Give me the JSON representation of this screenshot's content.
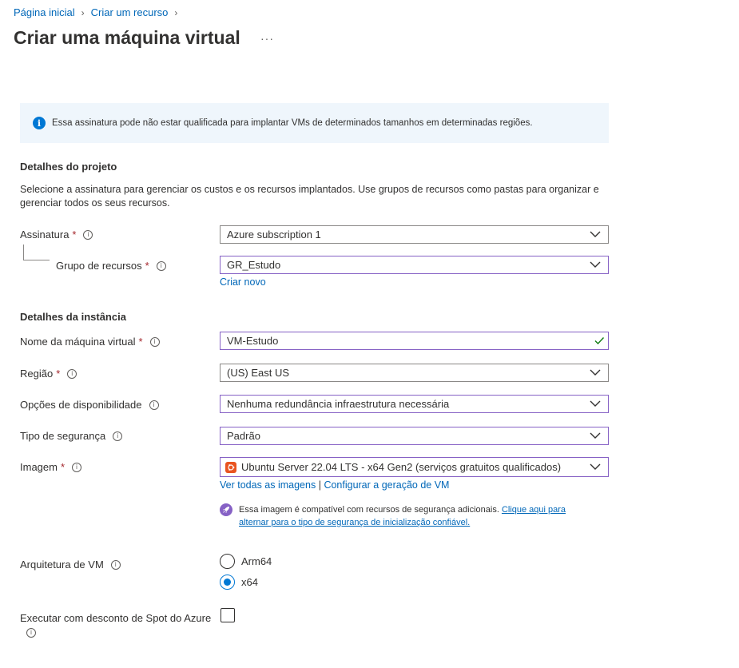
{
  "breadcrumb": {
    "items": [
      "Página inicial",
      "Criar um recurso"
    ]
  },
  "page": {
    "title": "Criar uma máquina virtual",
    "more": "···"
  },
  "banner": {
    "text": "Essa assinatura pode não estar qualificada para implantar VMs de determinados tamanhos em determinadas regiões."
  },
  "project": {
    "title": "Detalhes do projeto",
    "description": "Selecione a assinatura para gerenciar os custos e os recursos implantados. Use grupos de recursos como pastas para organizar e gerenciar todos os seus recursos.",
    "subscription": {
      "label": "Assinatura",
      "required": "*",
      "value": "Azure subscription 1"
    },
    "resource_group": {
      "label": "Grupo de recursos",
      "required": "*",
      "value": "GR_Estudo",
      "create_link": "Criar novo"
    }
  },
  "instance": {
    "title": "Detalhes da instância",
    "vm_name": {
      "label": "Nome da máquina virtual",
      "required": "*",
      "value": "VM-Estudo"
    },
    "region": {
      "label": "Região",
      "required": "*",
      "value": "(US) East US"
    },
    "availability": {
      "label": "Opções de disponibilidade",
      "value": "Nenhuma redundância infraestrutura necessária"
    },
    "security": {
      "label": "Tipo de segurança",
      "value": "Padrão"
    },
    "image": {
      "label": "Imagem",
      "required": "*",
      "value": "Ubuntu Server 22.04 LTS - x64 Gen2 (serviços gratuitos qualificados)",
      "see_all_link": "Ver todas as imagens",
      "separator": "|",
      "configure_link": "Configurar a geração de VM"
    },
    "notice": {
      "text": "Essa imagem é compatível com recursos de segurança adicionais.",
      "link_part1": "Clique aqui para",
      "link_part2": "alternar para o tipo de segurança de inicialização confiável."
    },
    "architecture": {
      "label": "Arquitetura de VM",
      "options": [
        "Arm64",
        "x64"
      ],
      "selected": "x64"
    },
    "spot": {
      "label": "Executar com desconto de Spot do Azure",
      "checked": false
    }
  },
  "info_glyph": "i",
  "colors": {
    "accent": "#0078d4",
    "link": "#0067b8",
    "required": "#a4262c",
    "focus_border": "#8661c5",
    "valid": "#107c10",
    "ubuntu": "#e95420"
  }
}
